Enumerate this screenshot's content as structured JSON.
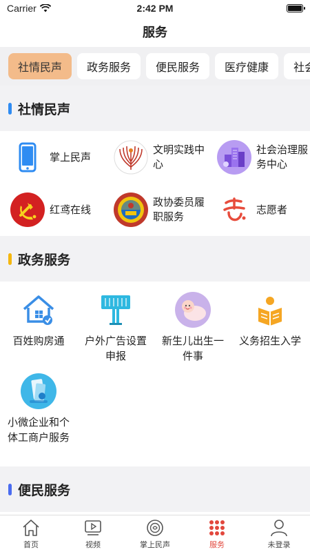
{
  "status": {
    "carrier": "Carrier",
    "time": "2:42 PM"
  },
  "nav": {
    "title": "服务"
  },
  "tabs": [
    {
      "label": "社情民声",
      "active": true
    },
    {
      "label": "政务服务"
    },
    {
      "label": "便民服务"
    },
    {
      "label": "医疗健康"
    },
    {
      "label": "社会保障"
    }
  ],
  "sections": {
    "social": {
      "title": "社情民声",
      "accent": "#2f8cf2",
      "items": [
        {
          "label": "掌上民声",
          "icon": "phone-icon"
        },
        {
          "label": "文明实践中心",
          "icon": "civilization-logo-icon"
        },
        {
          "label": "社会治理服务中心",
          "icon": "governance-icon"
        },
        {
          "label": "红鸢在线",
          "icon": "party-emblem-icon"
        },
        {
          "label": "政协委员履职服务",
          "icon": "cppcc-emblem-icon"
        },
        {
          "label": "志愿者",
          "icon": "volunteer-logo-icon"
        }
      ]
    },
    "gov": {
      "title": "政务服务",
      "accent": "#f5b70f",
      "items": [
        {
          "label": "百姓购房通",
          "icon": "house-icon"
        },
        {
          "label": "户外广告设置申报",
          "icon": "billboard-icon"
        },
        {
          "label": "新生儿出生一件事",
          "icon": "newborn-icon"
        },
        {
          "label": "义务招生入学",
          "icon": "reading-child-icon"
        },
        {
          "label": "小微企业和个体工商户服务",
          "icon": "business-icon"
        }
      ]
    },
    "convenience": {
      "title": "便民服务",
      "accent": "#4a6cf0"
    }
  },
  "bottom_nav": [
    {
      "label": "首页",
      "icon": "home-icon"
    },
    {
      "label": "视频",
      "icon": "video-icon"
    },
    {
      "label": "掌上民声",
      "icon": "voice-icon"
    },
    {
      "label": "服务",
      "icon": "service-grid-icon",
      "active": true
    },
    {
      "label": "未登录",
      "icon": "user-icon"
    }
  ],
  "colors": {
    "active_tab": "#f3bb8a",
    "active_nav": "#e2483d"
  }
}
